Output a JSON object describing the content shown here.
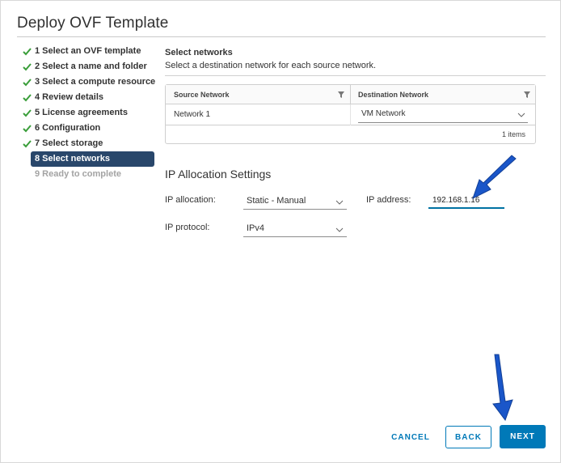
{
  "dialog": {
    "title": "Deploy OVF Template"
  },
  "wizard": {
    "steps": [
      {
        "label": "1 Select an OVF template",
        "state": "done"
      },
      {
        "label": "2 Select a name and folder",
        "state": "done"
      },
      {
        "label": "3 Select a compute resource",
        "state": "done"
      },
      {
        "label": "4 Review details",
        "state": "done"
      },
      {
        "label": "5 License agreements",
        "state": "done"
      },
      {
        "label": "6 Configuration",
        "state": "done"
      },
      {
        "label": "7 Select storage",
        "state": "done"
      },
      {
        "label": "8 Select networks",
        "state": "active"
      },
      {
        "label": "9 Ready to complete",
        "state": "disabled"
      }
    ]
  },
  "networks": {
    "title": "Select networks",
    "description": "Select a destination network for each source network.",
    "grid": {
      "columns": [
        "Source Network",
        "Destination Network"
      ],
      "rows": [
        {
          "source": "Network 1",
          "destination": "VM Network"
        }
      ],
      "footer": "1 items"
    }
  },
  "ip_settings": {
    "title": "IP Allocation Settings",
    "allocation_label": "IP allocation:",
    "allocation_value": "Static - Manual",
    "protocol_label": "IP protocol:",
    "protocol_value": "IPv4",
    "address_label": "IP address:",
    "address_value": "192.168.1.16"
  },
  "footer": {
    "cancel_label": "CANCEL",
    "back_label": "BACK",
    "next_label": "NEXT"
  },
  "colors": {
    "accent": "#0079b8",
    "active_step": "#29476b",
    "check": "#3a9e3a",
    "annotation_arrow": "#1a56c9"
  }
}
